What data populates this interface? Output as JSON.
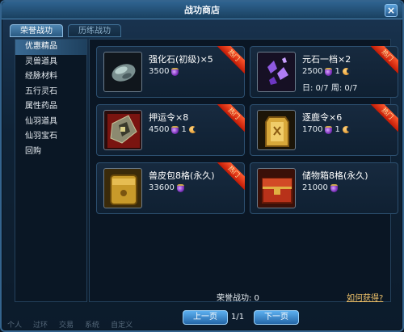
{
  "window": {
    "title": "战功商店"
  },
  "tabs": [
    {
      "label": "荣誉战功",
      "active": true
    },
    {
      "label": "历练战功",
      "active": false
    }
  ],
  "sidebar": {
    "items": [
      {
        "label": "优惠精品",
        "active": true
      },
      {
        "label": "灵兽道具"
      },
      {
        "label": "经脉材料"
      },
      {
        "label": "五行灵石"
      },
      {
        "label": "属性药品"
      },
      {
        "label": "仙羽道具"
      },
      {
        "label": "仙羽宝石"
      },
      {
        "label": "回购"
      }
    ]
  },
  "items": [
    {
      "name": "强化石(初级)×5",
      "price": "3500",
      "limit": "",
      "hot": "热门",
      "icon": "enhance-stone-icon"
    },
    {
      "name": "元石一档×2",
      "price": "2500",
      "limit": "日: 0/7  周: 0/7",
      "hot": "热门",
      "icon": "yuan-stone-icon",
      "badge": "1"
    },
    {
      "name": "押运令×8",
      "price": "4500",
      "limit": "",
      "hot": "热门",
      "icon": "escort-token-icon",
      "badge": "1"
    },
    {
      "name": "逐鹿令×6",
      "price": "1700",
      "limit": "",
      "hot": "热门",
      "icon": "zhulu-token-icon",
      "badge": "1"
    },
    {
      "name": "兽皮包8格(永久)",
      "price": "33600",
      "limit": "",
      "hot": "热门",
      "icon": "hide-bag-icon"
    },
    {
      "name": "储物箱8格(永久)",
      "price": "21000",
      "limit": "",
      "hot": "",
      "icon": "storage-chest-icon"
    }
  ],
  "footer": {
    "honor_label": "荣誉战功: 0",
    "how_link": "如何获得?",
    "prev_label": "上一页",
    "next_label": "下一页",
    "page": "1/1"
  },
  "bottom_bar": [
    "个人",
    "过环",
    "交易",
    "系统",
    "自定义"
  ],
  "colors": {
    "accent": "#2f6390",
    "hot": "#d0260a",
    "link": "#f0c36a"
  }
}
